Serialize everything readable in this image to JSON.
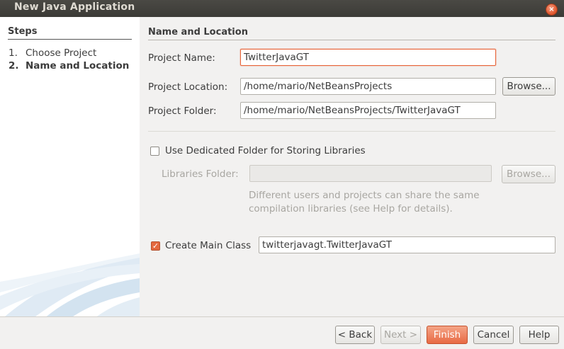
{
  "window": {
    "title": "New Java Application"
  },
  "steps": {
    "title": "Steps",
    "items": [
      {
        "num": "1.",
        "label": "Choose Project"
      },
      {
        "num": "2.",
        "label": "Name and Location"
      }
    ]
  },
  "panel": {
    "title": "Name and Location",
    "project_name_label": "Project Name:",
    "project_name_value": "TwitterJavaGT",
    "project_location_label": "Project Location:",
    "project_location_value": "/home/mario/NetBeansProjects",
    "project_folder_label": "Project Folder:",
    "project_folder_value": "/home/mario/NetBeansProjects/TwitterJavaGT",
    "browse_label": "Browse...",
    "dedicated_folder_label": "Use Dedicated Folder for Storing Libraries",
    "dedicated_folder_checked": false,
    "libraries_folder_label": "Libraries Folder:",
    "libraries_folder_value": "",
    "libraries_browse_label": "Browse...",
    "hint_line1": "Different users and projects can share the same",
    "hint_line2": "compilation libraries (see Help for details).",
    "create_main_label": "Create Main Class",
    "create_main_checked": true,
    "main_class_value": "twitterjavagt.TwitterJavaGT"
  },
  "footer": {
    "back_label": "< Back",
    "next_label": "Next >",
    "finish_label": "Finish",
    "cancel_label": "Cancel",
    "help_label": "Help"
  },
  "colors": {
    "accent": "#e86a44",
    "focus": "#e8663b",
    "titlebar": "#3c3b37"
  }
}
